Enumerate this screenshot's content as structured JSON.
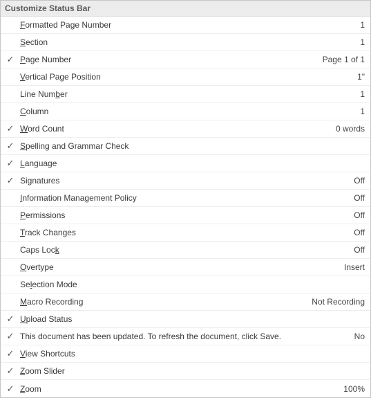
{
  "title": "Customize Status Bar",
  "items": [
    {
      "checked": false,
      "accel": "F",
      "rest": "ormatted Page Number",
      "value": "1"
    },
    {
      "checked": false,
      "accel": "S",
      "rest": "ection",
      "value": "1"
    },
    {
      "checked": true,
      "accel": "P",
      "rest": "age Number",
      "value": "Page 1 of 1"
    },
    {
      "checked": false,
      "accel": "V",
      "rest": "ertical Page Position",
      "value": "1\""
    },
    {
      "checked": false,
      "pre": "Line Num",
      "accel": "b",
      "rest": "er",
      "value": "1"
    },
    {
      "checked": false,
      "accel": "C",
      "rest": "olumn",
      "value": "1"
    },
    {
      "checked": true,
      "accel": "W",
      "rest": "ord Count",
      "value": "0 words"
    },
    {
      "checked": true,
      "accel": "S",
      "rest": "pelling and Grammar Check",
      "value": ""
    },
    {
      "checked": true,
      "accel": "L",
      "rest": "anguage",
      "value": ""
    },
    {
      "checked": true,
      "pre": "Si",
      "accel": "g",
      "rest": "natures",
      "value": "Off"
    },
    {
      "checked": false,
      "accel": "I",
      "rest": "nformation Management Policy",
      "value": "Off"
    },
    {
      "checked": false,
      "accel": "P",
      "rest": "ermissions",
      "value": "Off"
    },
    {
      "checked": false,
      "accel": "T",
      "rest": "rack Changes",
      "value": "Off"
    },
    {
      "checked": false,
      "pre": "Caps Loc",
      "accel": "k",
      "rest": "",
      "value": "Off"
    },
    {
      "checked": false,
      "accel": "O",
      "rest": "vertype",
      "value": "Insert"
    },
    {
      "checked": false,
      "pre": "Se",
      "accel": "l",
      "rest": "ection Mode",
      "value": ""
    },
    {
      "checked": false,
      "accel": "M",
      "rest": "acro Recording",
      "value": "Not Recording"
    },
    {
      "checked": true,
      "accel": "U",
      "rest": "pload Status",
      "value": ""
    },
    {
      "checked": true,
      "plain": "This document has been updated. To refresh the document, click Save.",
      "value": "No"
    },
    {
      "checked": true,
      "accel": "V",
      "rest": "iew Shortcuts",
      "value": ""
    },
    {
      "checked": true,
      "accel": "Z",
      "rest": "oom Slider",
      "value": ""
    },
    {
      "checked": true,
      "accel": "Z",
      "rest": "oom",
      "value": "100%"
    }
  ]
}
